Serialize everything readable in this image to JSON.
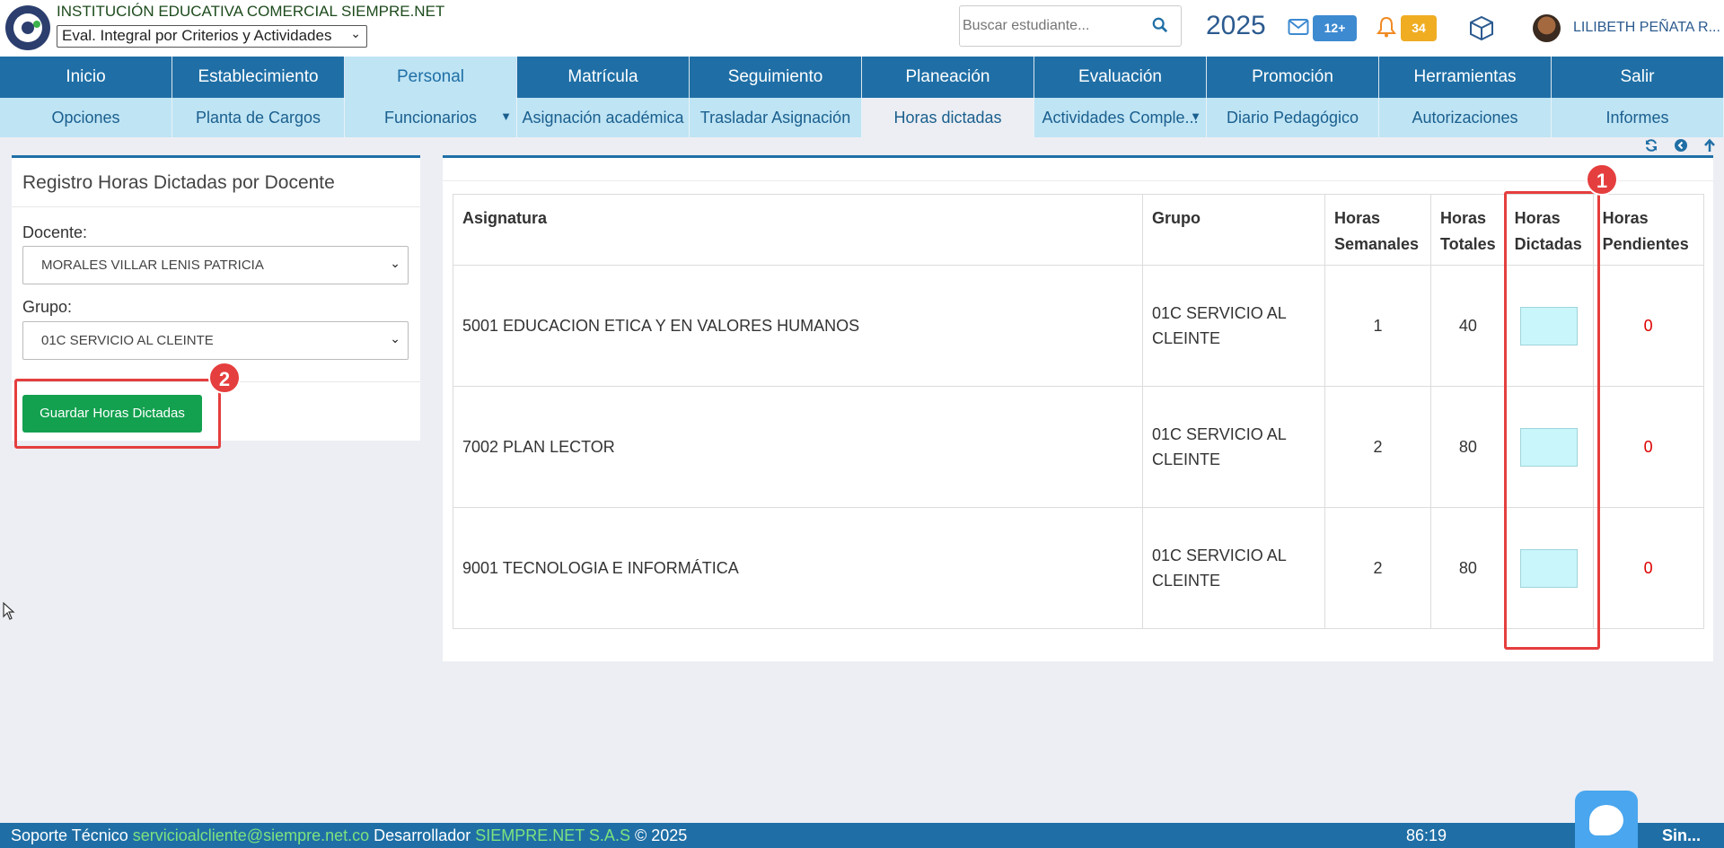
{
  "header": {
    "institution": "INSTITUCIÓN EDUCATIVA COMERCIAL SIEMPRE.NET",
    "eval_mode": "Eval. Integral por Criterios y Actividades",
    "search_placeholder": "Buscar estudiante...",
    "year": "2025",
    "mail_badge": "12+",
    "notif_badge": "34",
    "user": "LILIBETH PEÑATA R..."
  },
  "main_menu": [
    "Inicio",
    "Establecimiento",
    "Personal",
    "Matrícula",
    "Seguimiento",
    "Planeación",
    "Evaluación",
    "Promoción",
    "Herramientas",
    "Salir"
  ],
  "sub_menu": [
    "Opciones",
    "Planta de Cargos",
    "Funcionarios",
    "Asignación académica",
    "Trasladar Asignación",
    "Horas dictadas",
    "Actividades Comple...",
    "Diario Pedagógico",
    "Autorizaciones",
    "Informes"
  ],
  "left_panel": {
    "title": "Registro Horas Dictadas por Docente",
    "docente_label": "Docente:",
    "docente_value": "MORALES VILLAR LENIS PATRICIA",
    "grupo_label": "Grupo:",
    "grupo_value": "01C SERVICIO AL CLEINTE",
    "save_button": "Guardar Horas Dictadas"
  },
  "table": {
    "headers": {
      "asignatura": "Asignatura",
      "grupo": "Grupo",
      "semanales": "Horas Semanales",
      "totales": "Horas Totales",
      "dictadas": "Horas Dictadas",
      "pendientes": "Horas Pendientes"
    },
    "rows": [
      {
        "asignatura": "5001 EDUCACION ETICA Y EN VALORES HUMANOS",
        "grupo": "01C SERVICIO AL CLEINTE",
        "semanales": "1",
        "totales": "40",
        "dictadas": "",
        "pendientes": "0"
      },
      {
        "asignatura": "7002 PLAN LECTOR",
        "grupo": "01C SERVICIO AL CLEINTE",
        "semanales": "2",
        "totales": "80",
        "dictadas": "",
        "pendientes": "0"
      },
      {
        "asignatura": "9001 TECNOLOGIA E INFORMÁTICA",
        "grupo": "01C SERVICIO AL CLEINTE",
        "semanales": "2",
        "totales": "80",
        "dictadas": "",
        "pendientes": "0"
      }
    ]
  },
  "annotations": [
    "1",
    "2"
  ],
  "footer": {
    "soporte_label": "Soporte Técnico",
    "soporte_email": "servicioalcliente@siempre.net.co",
    "dev_label": "Desarrollador",
    "dev_name": "SIEMPRE.NET S.A.S",
    "copyright": "© 2025",
    "time": "86:19",
    "brand": "Sin..."
  },
  "colors": {
    "primary": "#1f6fa6",
    "submenu": "#bfe4f4",
    "save_green": "#13a14f",
    "annotation_red": "#e53e3e",
    "pending_red": "#dd0000",
    "input_cyan": "#c8f6fb"
  }
}
